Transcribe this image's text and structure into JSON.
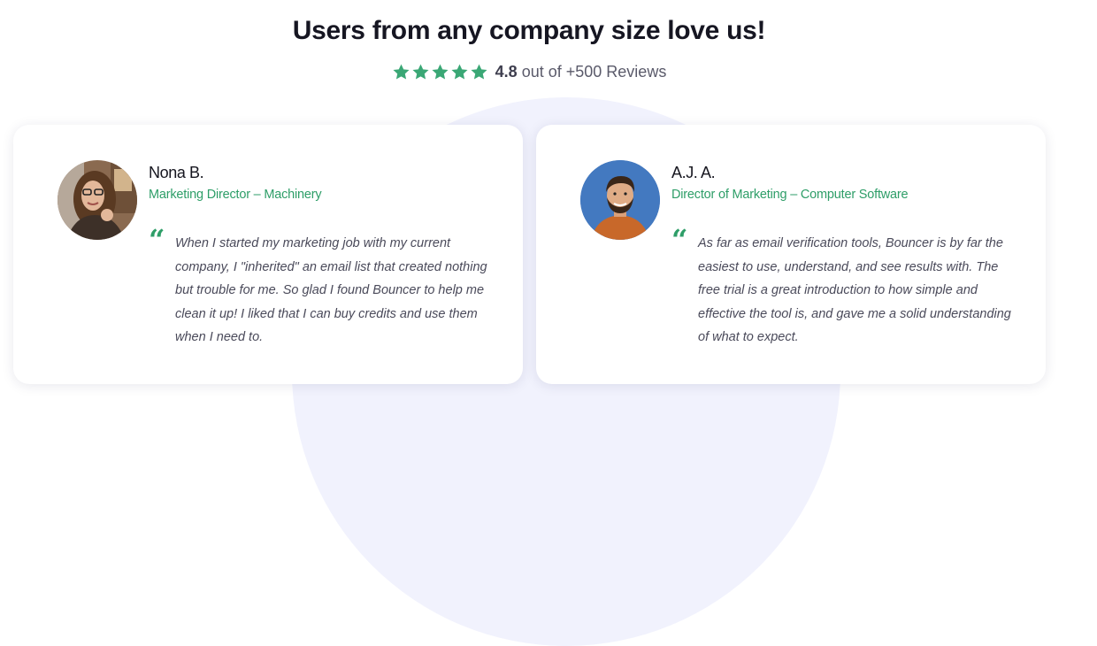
{
  "section": {
    "heading": "Users from any company size love us!",
    "rating": {
      "stars": 5,
      "star_color": "#3aa775",
      "score": "4.8",
      "suffix": "out of +500 Reviews"
    }
  },
  "colors": {
    "accent": "#2e9e68",
    "background_circle": "#f1f2fd"
  },
  "testimonials": [
    {
      "name": "Nona B.",
      "role": "Marketing Director – Machinery",
      "quote_mark": "“",
      "quote": "When I started my marketing job with my current company, I \"inherited\" an email list that created nothing but trouble for me. So glad I found Bouncer to help me clean it up! I liked that I can buy credits and use them when I need to.",
      "avatar_icon": "woman-avatar"
    },
    {
      "name": "A.J. A.",
      "role": "Director of Marketing – Computer Software",
      "quote_mark": "“",
      "quote": "As far as email verification tools, Bouncer is by far the easiest to use, understand, and see results with. The free trial is a great introduction to how simple and effective the tool is, and gave me a solid understanding of what to expect.",
      "avatar_icon": "man-avatar"
    }
  ]
}
